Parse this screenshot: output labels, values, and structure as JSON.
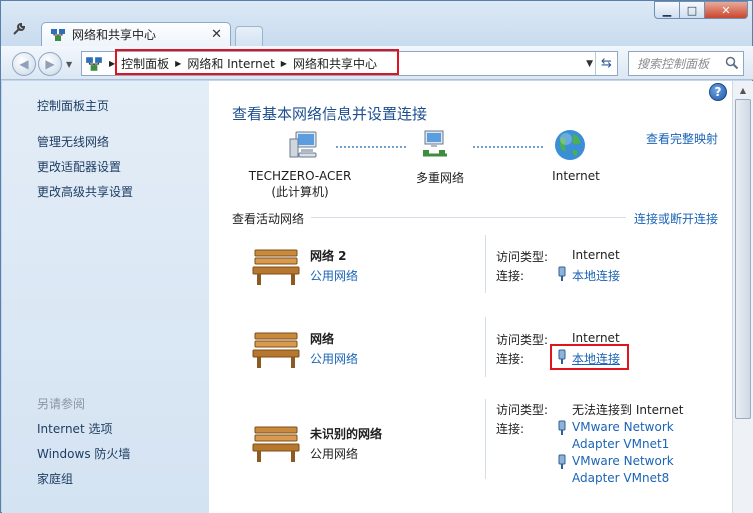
{
  "window": {
    "tab_title": "网络和共享中心",
    "buttons": {
      "minimize": "▁",
      "maximize": "□",
      "close": "✕"
    }
  },
  "address_bar": {
    "crumbs": [
      "控制面板",
      "网络和 Internet",
      "网络和共享中心"
    ],
    "search_placeholder": "搜索控制面板"
  },
  "sidebar": {
    "home": "控制面板主页",
    "tasks": [
      "管理无线网络",
      "更改适配器设置",
      "更改高级共享设置"
    ],
    "see_also_header": "另请参阅",
    "see_also": [
      "Internet 选项",
      "Windows 防火墙",
      "家庭组"
    ]
  },
  "main": {
    "title": "查看基本网络信息并设置连接",
    "full_map_link": "查看完整映射",
    "map": {
      "computer_name": "TECHZERO-ACER",
      "computer_sub": "(此计算机)",
      "middle": "多重网络",
      "internet": "Internet"
    },
    "active_networks_label": "查看活动网络",
    "connect_disconnect_link": "连接或断开连接",
    "access_type_label": "访问类型:",
    "connection_label": "连接:",
    "networks": [
      {
        "name": "网络  2",
        "category": "公用网络",
        "access": "Internet",
        "connections": [
          "本地连接"
        ]
      },
      {
        "name": "网络",
        "category": "公用网络",
        "access": "Internet",
        "connections": [
          "本地连接"
        ]
      },
      {
        "name": "未识别的网络",
        "category": "公用网络",
        "access": "无法连接到 Internet",
        "connections": [
          "VMware Network Adapter VMnet1",
          "VMware Network Adapter VMnet8"
        ]
      }
    ],
    "vm1_lines": [
      "VMware Network",
      "Adapter VMnet1"
    ],
    "vm8_lines": [
      "VMware Network",
      "Adapter VMnet8"
    ]
  },
  "colors": {
    "link": "#1a64b5",
    "title": "#1e4f8f",
    "highlight": "#e0141f",
    "sidebar_bg": "#d4e3f2"
  }
}
